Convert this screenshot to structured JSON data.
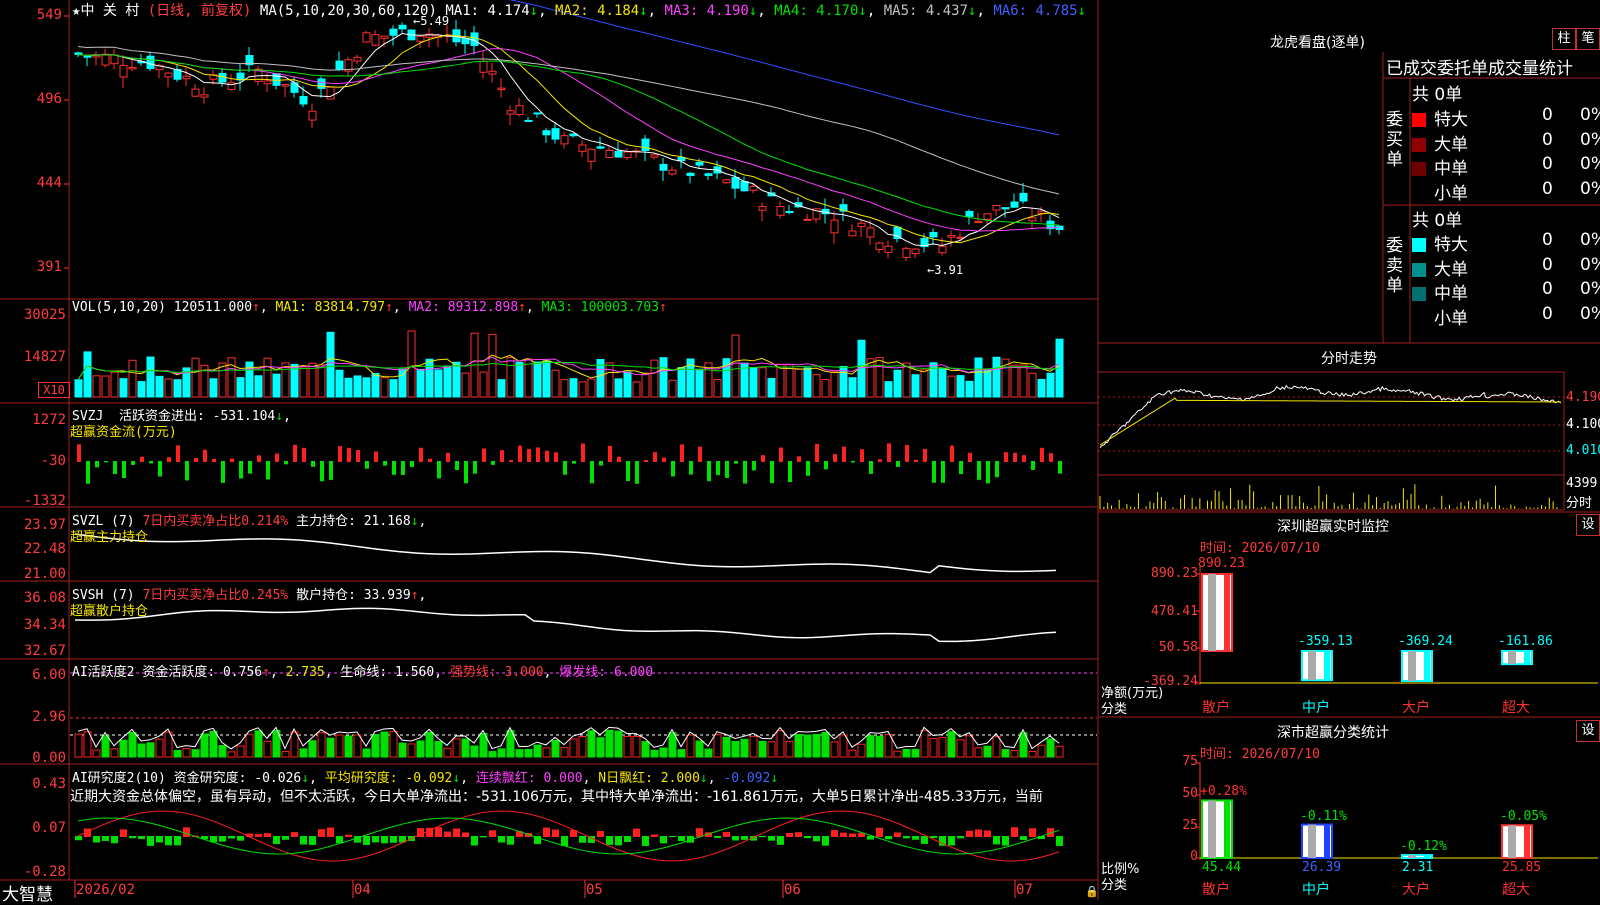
{
  "colors": {
    "up": "#ff3030",
    "down": "#00ffff",
    "frame": "#a02020",
    "volHist": "#00ff00"
  },
  "main": {
    "title_icon": "star-icon",
    "stock_name": "中 关 村",
    "period": "(日线, 前复权)",
    "ma_label": "MA(5,10,20,30,60,120)",
    "ma1": "MA1: 4.174",
    "ma2": "MA2: 4.184",
    "ma3": "MA3: 4.190",
    "ma4": "MA4: 4.170",
    "ma5": "MA5: 4.437",
    "ma6": "MA6: 4.785",
    "high_mark": "5.49",
    "low_mark": "3.91",
    "axis": [
      "549",
      "496",
      "444",
      "391"
    ]
  },
  "vol": {
    "label": "VOL(5,10,20)",
    "value": "120511.000",
    "ma1": "MA1: 83814.797",
    "ma2": "MA2: 89312.898",
    "ma3": "MA3: 100003.703",
    "axis": [
      "30025",
      "14827"
    ],
    "unit": "X10"
  },
  "svzj": {
    "label": "SVZJ",
    "text": "活跃资金进出: -531.104",
    "sub": "超赢资金流(万元)",
    "axis": [
      "1272",
      "-30",
      "-1332"
    ]
  },
  "svzl": {
    "label": "SVZL (7)",
    "text1": "7日内买卖净占比0.214%",
    "text2": "主力持仓: 21.168",
    "sub": "超赢主力持仓",
    "axis": [
      "23.97",
      "22.48",
      "21.00"
    ]
  },
  "svsh": {
    "label": "SVSH (7)",
    "text1": "7日内买卖净占比0.245%",
    "text2": "散户持仓: 33.939",
    "sub": "超赢散户持仓",
    "axis": [
      "36.08",
      "34.34",
      "32.67"
    ]
  },
  "ai_act": {
    "label": "AI活跃度2",
    "t1": "资金活跃度: 0.756",
    "t2": "2.735",
    "t3": "生命线: 1.560",
    "t4": "强势线: 3.000",
    "t5": "爆发线: 6.000",
    "axis": [
      "6.00",
      "2.96",
      "0.00"
    ]
  },
  "ai_res": {
    "label": "AI研究度2(10)",
    "t1": "资金研究度: -0.026",
    "t2": "平均研究度: -0.092",
    "t3": "连续飘红: 0.000",
    "t4": "N日飘红: 2.000",
    "t5": "-0.092",
    "comment": "近期大资金总体偏空，虽有异动，但不太活跃，今日大单净流出：-531.106万元，其中特大单净流出：-161.861万元，大单5日累计净出-485.33万元，当前",
    "axis": [
      "0.43",
      "0.07",
      "-0.28"
    ]
  },
  "bottom": {
    "brand": "大智慧",
    "dates": [
      "2026/02",
      "04",
      "05",
      "06",
      "07"
    ]
  },
  "lhb": {
    "title": "龙虎看盘(逐单)",
    "btn1": "柱",
    "btn2": "笔",
    "header": "已成交委托单成交量统计",
    "buy_label": "委买单",
    "sell_label": "委卖单",
    "buy_total": "共 0单",
    "sell_total": "共 0单",
    "buy_rows": [
      {
        "name": "特大",
        "n": "0",
        "p": "0%",
        "color": "#ff0000"
      },
      {
        "name": "大单",
        "n": "0",
        "p": "0%",
        "color": "#900000"
      },
      {
        "name": "中单",
        "n": "0",
        "p": "0%",
        "color": "#700000"
      },
      {
        "name": "小单",
        "n": "0",
        "p": "0%",
        "color": "#000000"
      }
    ],
    "sell_rows": [
      {
        "name": "特大",
        "n": "0",
        "p": "0%",
        "color": "#00ffff"
      },
      {
        "name": "大单",
        "n": "0",
        "p": "0%",
        "color": "#009090"
      },
      {
        "name": "中单",
        "n": "0",
        "p": "0%",
        "color": "#007070"
      },
      {
        "name": "小单",
        "n": "0",
        "p": "0%",
        "color": "#000000"
      }
    ]
  },
  "fenshi": {
    "title": "分时走势",
    "axis": [
      "4.190",
      "4.100",
      "4.010"
    ],
    "vol_axis": "4399",
    "vol_label": "分时"
  },
  "sz_monitor": {
    "title": "深圳超赢实时监控",
    "btn": "设",
    "time": "时间: 2026/07/10",
    "axis": [
      "890.23",
      "470.41",
      "50.58",
      "-369.24"
    ],
    "unit": "净额(万元)",
    "cat_label": "分类",
    "bars": [
      {
        "name": "散户",
        "value": 890.23,
        "label": "890.23"
      },
      {
        "name": "中户",
        "value": -359.13,
        "label": "-359.13"
      },
      {
        "name": "大户",
        "value": -369.24,
        "label": "-369.24"
      },
      {
        "name": "超大",
        "value": -161.86,
        "label": "-161.86"
      }
    ]
  },
  "sz_class": {
    "title": "深市超赢分类统计",
    "btn": "设",
    "time": "时间: 2026/07/10",
    "axis": [
      "75",
      "50",
      "25",
      "0"
    ],
    "unit": "比例%",
    "cat_label": "分类",
    "bars": [
      {
        "name": "散户",
        "value": 45.44,
        "label": "45.44",
        "delta": "+0.28%"
      },
      {
        "name": "中户",
        "value": 26.39,
        "label": "26.39",
        "delta": "-0.11%"
      },
      {
        "name": "大户",
        "value": 2.31,
        "label": "2.31",
        "delta": "-0.12%"
      },
      {
        "name": "超大",
        "value": 25.85,
        "label": "25.85",
        "delta": "-0.05%"
      }
    ]
  }
}
